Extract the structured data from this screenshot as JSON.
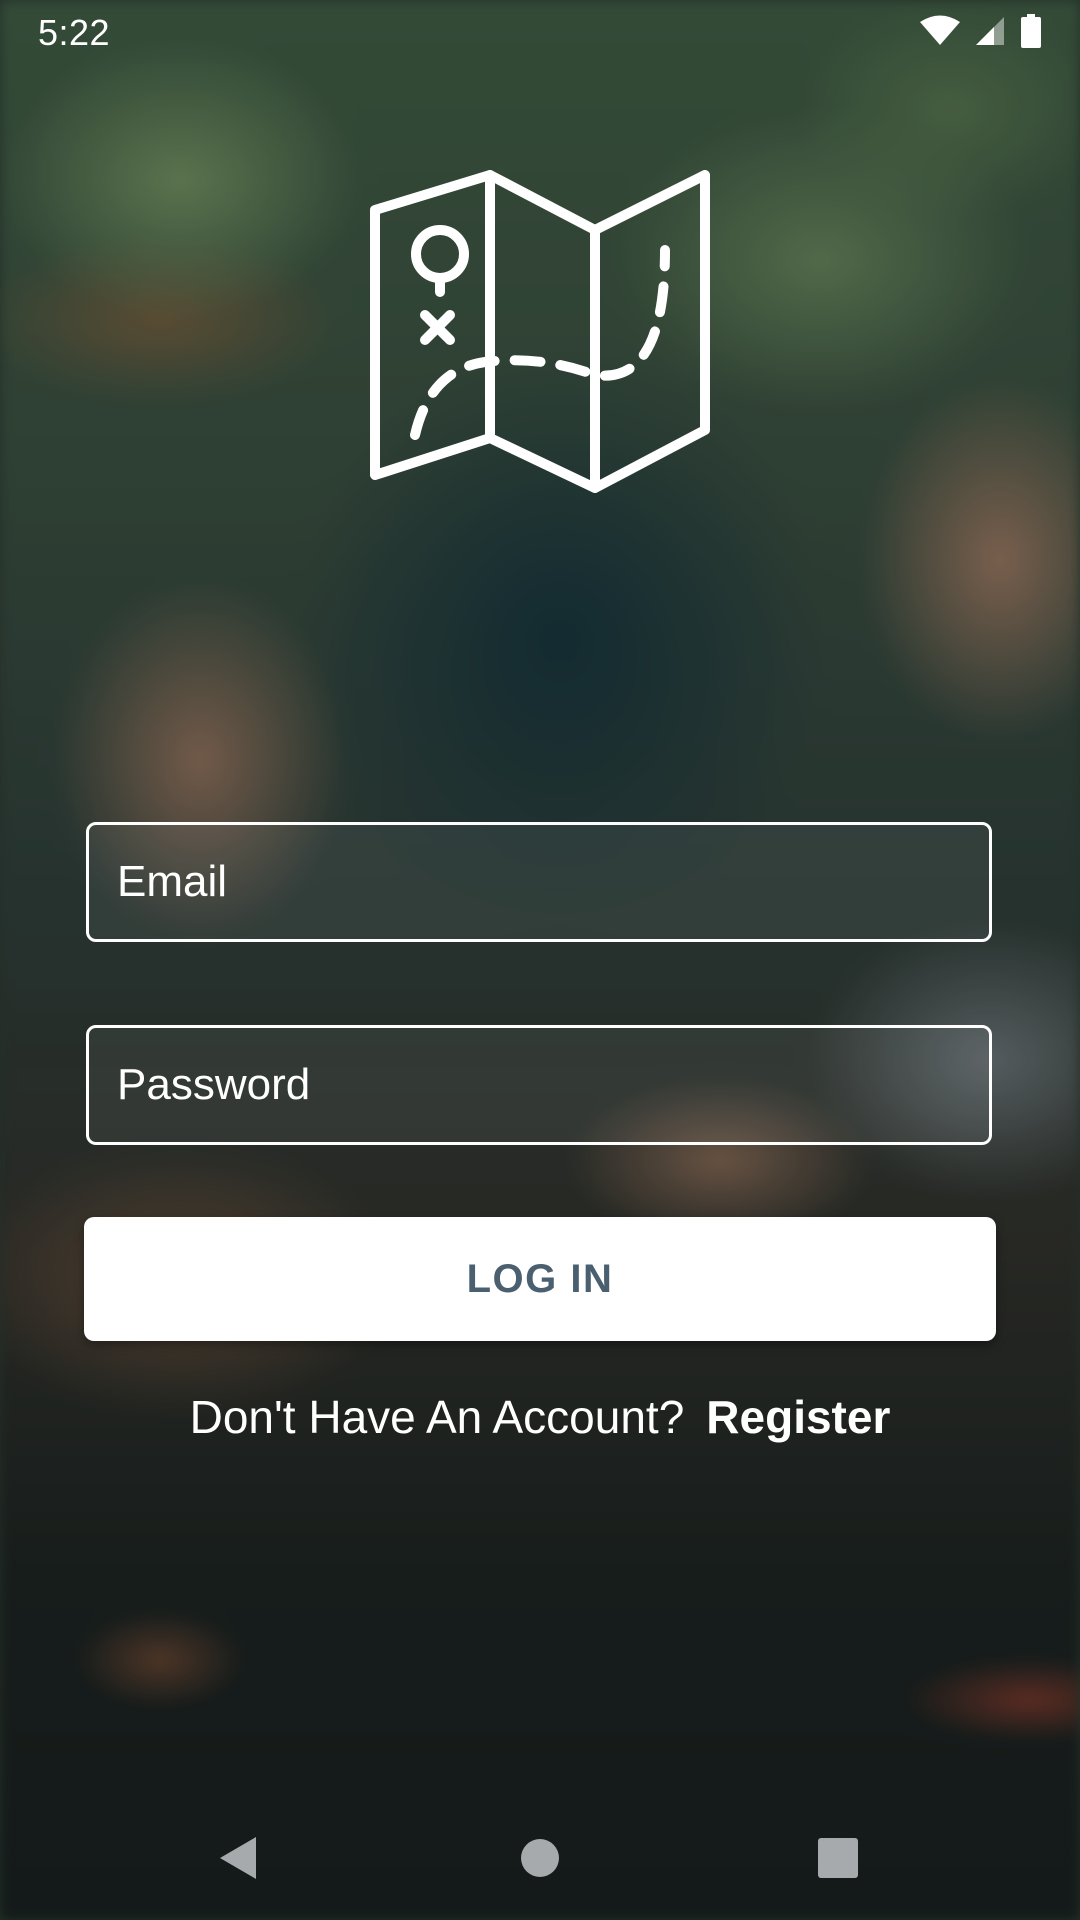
{
  "status_bar": {
    "time": "5:22",
    "icons": [
      "wifi-icon",
      "cell-signal-icon",
      "battery-icon"
    ]
  },
  "logo": {
    "icon": "treasure-map-icon"
  },
  "login_form": {
    "email_placeholder": "Email",
    "email_value": "",
    "password_placeholder": "Password",
    "password_value": "",
    "login_button_label": "LOG IN",
    "register_prompt": "Don't Have An Account?",
    "register_link_label": "Register"
  },
  "nav_bar": {
    "icons": [
      "back-icon",
      "home-icon",
      "recents-icon"
    ]
  },
  "colors": {
    "text": "#ffffff",
    "button_background": "#ffffff",
    "button_text": "#4a6070",
    "nav_icon": "#a6aaad"
  }
}
